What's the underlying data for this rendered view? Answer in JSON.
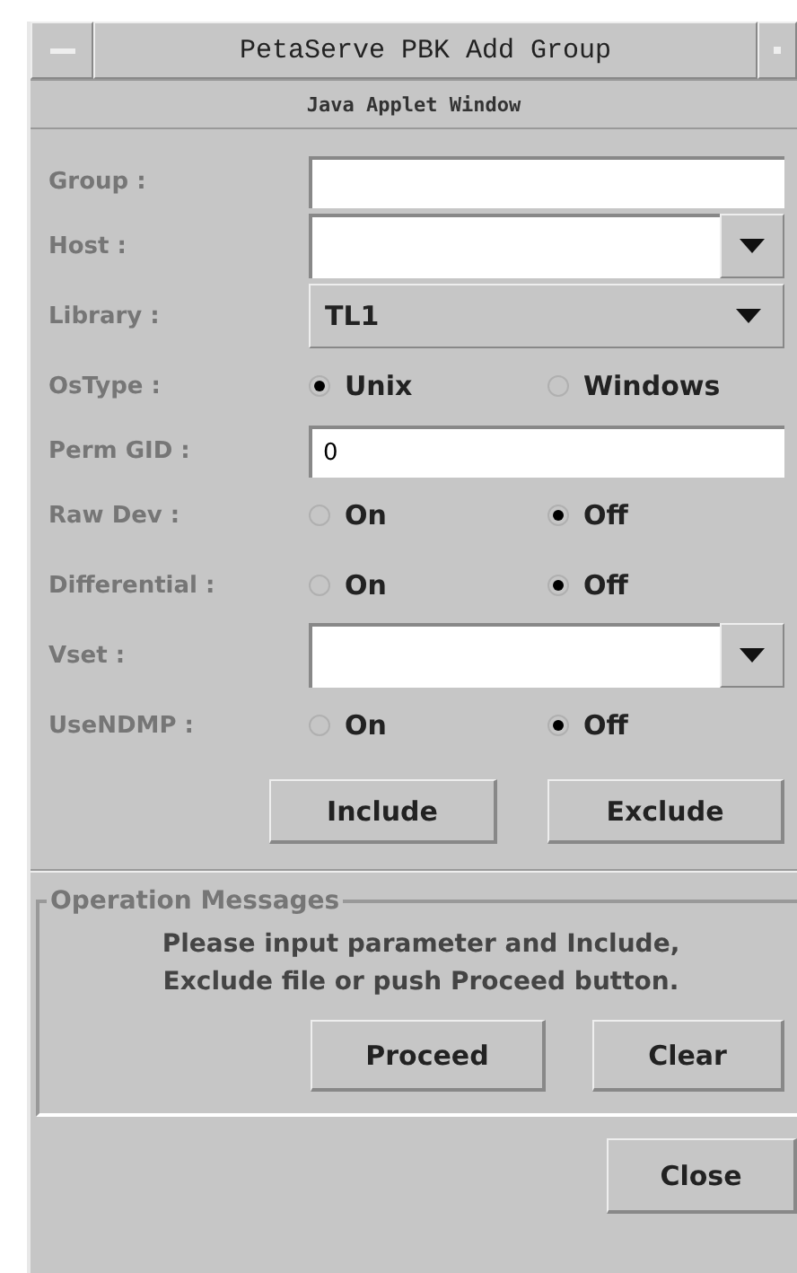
{
  "window": {
    "title": "PetaServe PBK Add Group",
    "subtitle": "Java Applet Window"
  },
  "form": {
    "rows": [
      {
        "kind": "text",
        "label": "Group :",
        "value": ""
      },
      {
        "kind": "combo",
        "label": "Host :",
        "value": ""
      },
      {
        "kind": "select",
        "label": "Library :",
        "value": "TL1"
      },
      {
        "kind": "radio",
        "label": "OsType :",
        "options": [
          {
            "label": "Unix",
            "selected": true
          },
          {
            "label": "Windows",
            "selected": false
          }
        ]
      },
      {
        "kind": "text",
        "label": "Perm GID :",
        "value": "0"
      },
      {
        "kind": "radio",
        "label": "Raw Dev :",
        "options": [
          {
            "label": "On",
            "selected": false
          },
          {
            "label": "Off",
            "selected": true
          }
        ]
      },
      {
        "kind": "radio",
        "label": "Differential :",
        "options": [
          {
            "label": "On",
            "selected": false
          },
          {
            "label": "Off",
            "selected": true
          }
        ]
      },
      {
        "kind": "combo",
        "label": "Vset :",
        "value": ""
      },
      {
        "kind": "radio",
        "label": "UseNDMP :",
        "options": [
          {
            "label": "On",
            "selected": false
          },
          {
            "label": "Off",
            "selected": true
          }
        ]
      }
    ],
    "buttons": [
      "Include",
      "Exclude"
    ]
  },
  "messages": {
    "title": "Operation Messages",
    "lines": [
      "Please input parameter and Include,",
      "Exclude file or push Proceed button."
    ],
    "buttons": [
      "Proceed",
      "Clear"
    ]
  },
  "footer": {
    "buttons": [
      "Close"
    ]
  }
}
